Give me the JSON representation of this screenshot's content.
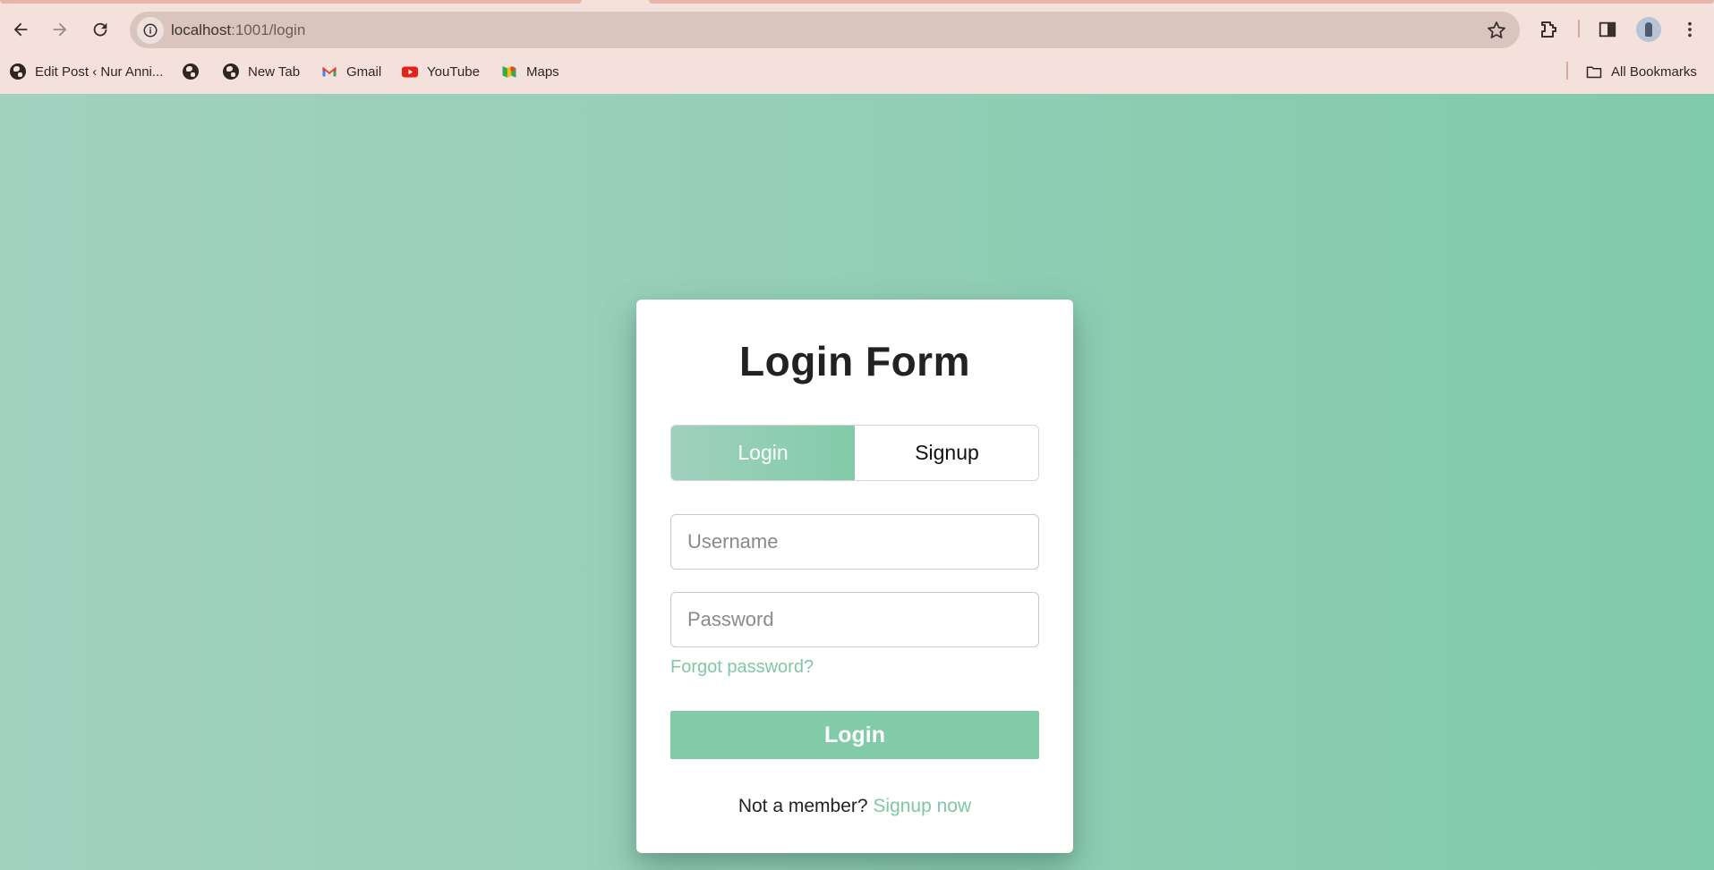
{
  "browser": {
    "url_host": "localhost",
    "url_path": ":1001/login",
    "bookmarks": [
      {
        "label": "Edit Post ‹ Nur Anni...",
        "icon": "globe-icon"
      },
      {
        "label": "",
        "icon": "globe-icon"
      },
      {
        "label": "New Tab",
        "icon": "globe-icon"
      },
      {
        "label": "Gmail",
        "icon": "gmail-icon"
      },
      {
        "label": "YouTube",
        "icon": "youtube-icon"
      },
      {
        "label": "Maps",
        "icon": "maps-icon"
      }
    ],
    "all_bookmarks_label": "All Bookmarks",
    "colors": {
      "chrome_bg": "#f4e1db",
      "omnibox_bg": "#d9c4be"
    }
  },
  "form": {
    "title": "Login Form",
    "tabs": {
      "login": "Login",
      "signup": "Signup",
      "active": "login"
    },
    "username_placeholder": "Username",
    "password_placeholder": "Password",
    "forgot_label": "Forgot password?",
    "submit_label": "Login",
    "footer_text": "Not a member?",
    "footer_link": "Signup now"
  },
  "colors": {
    "accent": "#82cba9",
    "page_bg_start": "#a2d1c0",
    "page_bg_end": "#7fcaa9"
  }
}
